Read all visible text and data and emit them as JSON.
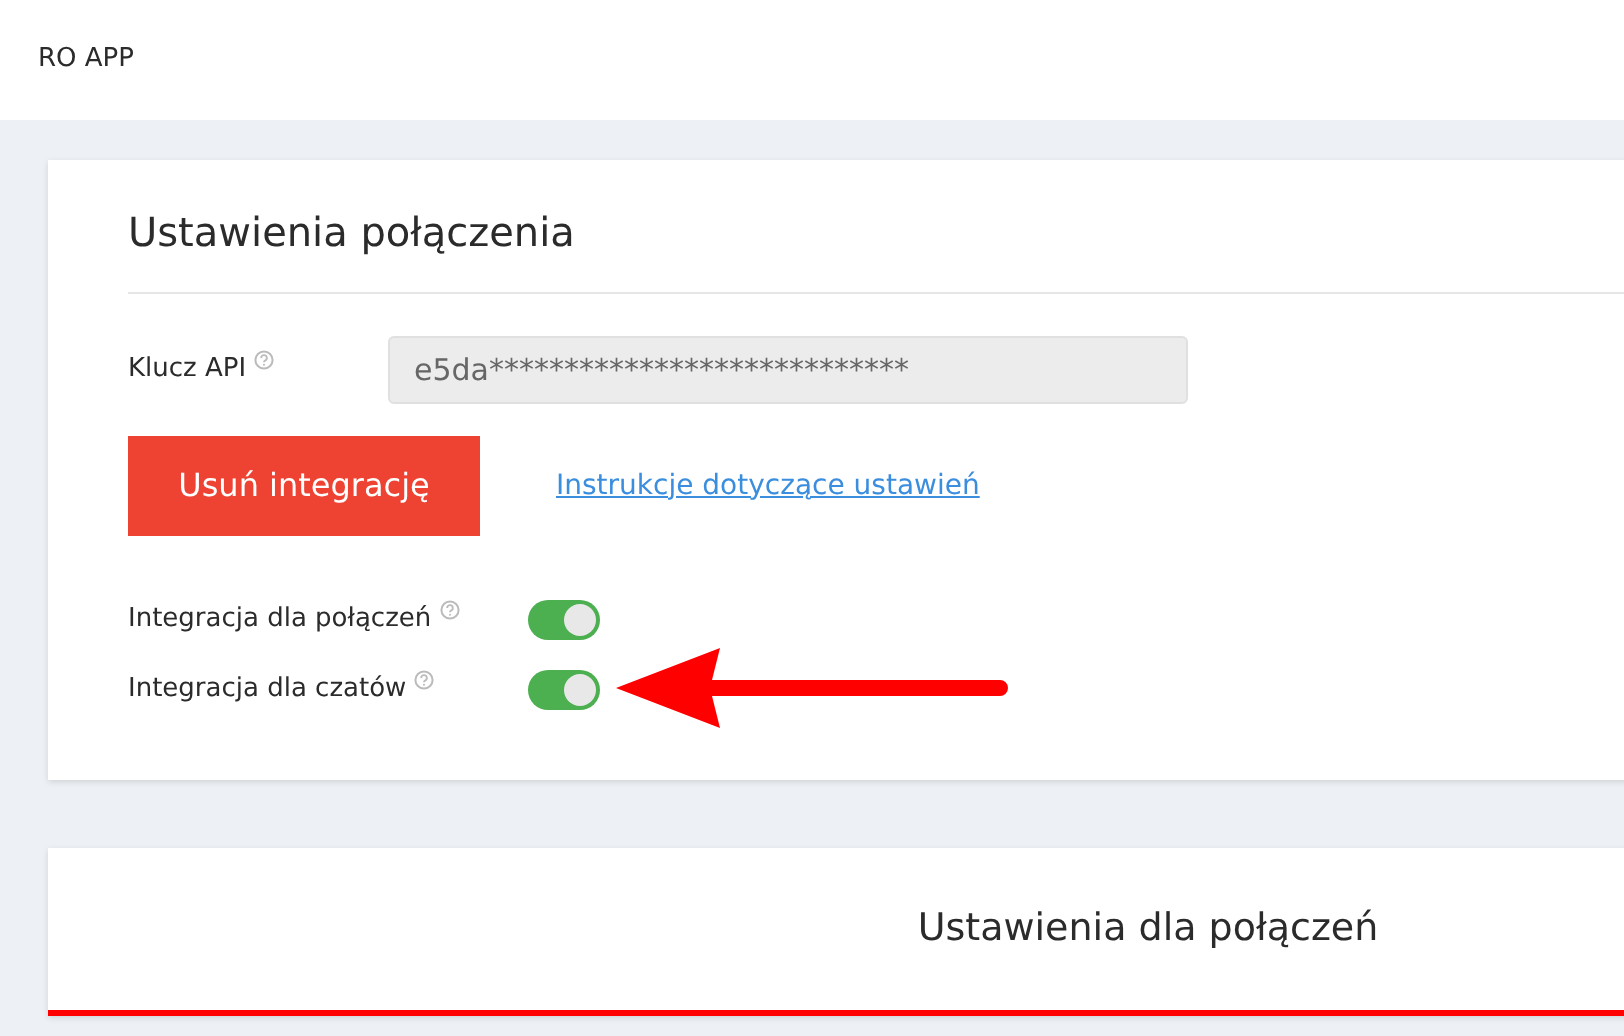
{
  "header": {
    "title": "RO APP"
  },
  "connection_settings": {
    "title": "Ustawienia połączenia",
    "api_key": {
      "label": "Klucz API",
      "value": "e5da****************************"
    },
    "delete_button": "Usuń integrację",
    "help_link": "Instrukcje dotyczące ustawień",
    "toggles": [
      {
        "label": "Integracja dla połączeń",
        "on": true
      },
      {
        "label": "Integracja dla czatów",
        "on": true
      }
    ]
  },
  "call_settings": {
    "title": "Ustawienia dla połączeń"
  }
}
